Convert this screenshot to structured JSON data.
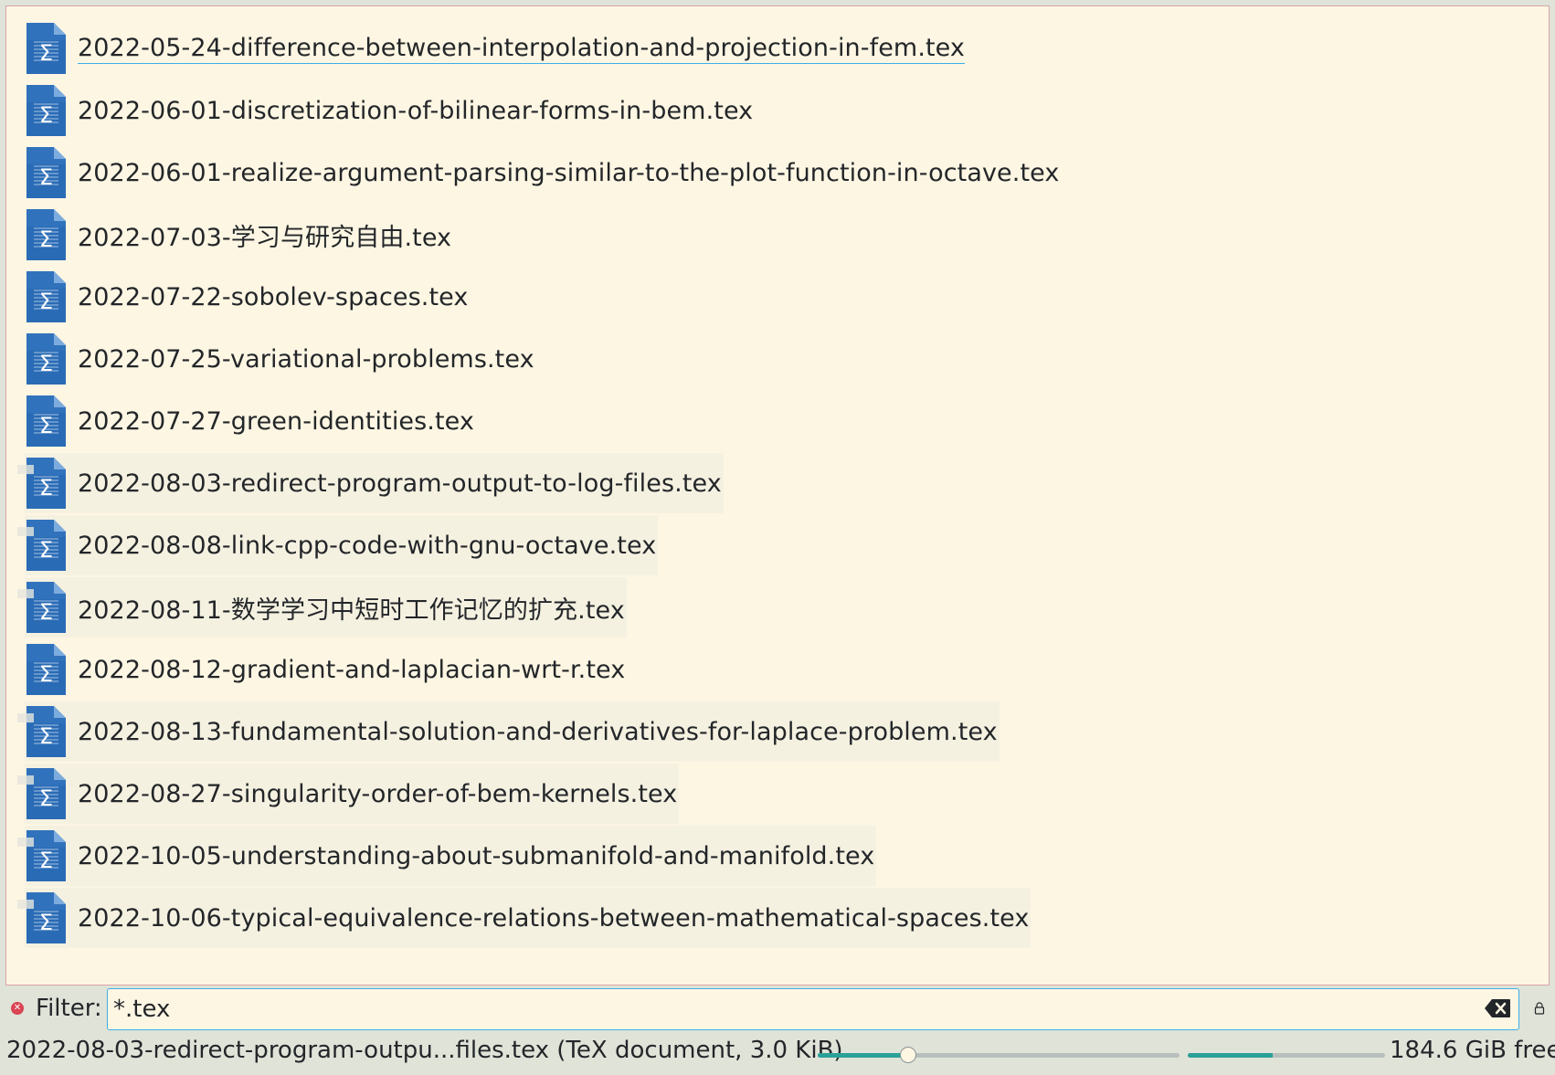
{
  "files": [
    {
      "name": "2022-05-24-difference-between-interpolation-and-projection-in-fem.tex",
      "current": true
    },
    {
      "name": "2022-06-01-discretization-of-bilinear-forms-in-bem.tex"
    },
    {
      "name": "2022-06-01-realize-argument-parsing-similar-to-the-plot-function-in-octave.tex"
    },
    {
      "name": "2022-07-03-学习与研究自由.tex"
    },
    {
      "name": "2022-07-22-sobolev-spaces.tex"
    },
    {
      "name": "2022-07-25-variational-problems.tex"
    },
    {
      "name": "2022-07-27-green-identities.tex"
    },
    {
      "name": "2022-08-03-redirect-program-output-to-log-files.tex",
      "shaded": true
    },
    {
      "name": "2022-08-08-link-cpp-code-with-gnu-octave.tex",
      "shaded": true
    },
    {
      "name": "2022-08-11-数学学习中短时工作记忆的扩充.tex",
      "shaded": true
    },
    {
      "name": "2022-08-12-gradient-and-laplacian-wrt-r.tex"
    },
    {
      "name": "2022-08-13-fundamental-solution-and-derivatives-for-laplace-problem.tex",
      "shaded": true
    },
    {
      "name": "2022-08-27-singularity-order-of-bem-kernels.tex",
      "shaded": true
    },
    {
      "name": "2022-10-05-understanding-about-submanifold-and-manifold.tex",
      "shaded": true
    },
    {
      "name": "2022-10-06-typical-equivalence-relations-between-mathematical-spaces.tex",
      "shaded": true
    }
  ],
  "file_icon": "tex-document-icon",
  "filter": {
    "label": "Filter:",
    "value": "*.tex"
  },
  "status": {
    "selected_info": "2022-08-03-redirect-program-outpu...files.tex (TeX document, 3.0 KiB)",
    "zoom_level": 0.25,
    "disk_used_fraction": 0.43,
    "free_space": "184.6 GiB free"
  },
  "colors": {
    "view_background": "#fdf6e3",
    "accent": "#3daee9",
    "slider_fill": "#2aa198",
    "icon_blue": "#2a6bb5"
  }
}
